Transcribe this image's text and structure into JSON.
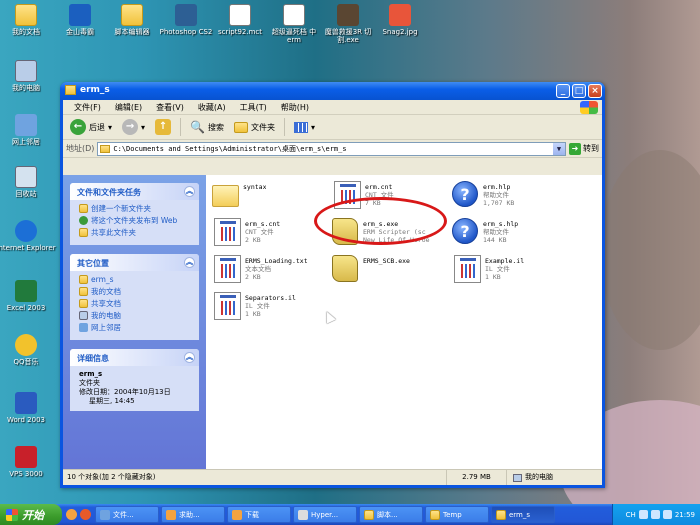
{
  "desktop": {
    "icons": [
      {
        "label": "我的文档"
      },
      {
        "label": "金山毒霸"
      },
      {
        "label": "脚本编辑器"
      },
      {
        "label": "Photoshop CS2"
      },
      {
        "label": "script92.mct"
      },
      {
        "label": "超级逼死档 中 erm"
      },
      {
        "label": "魔兽救援3R 切割.exe"
      },
      {
        "label": "Snag2.jpg"
      },
      {
        "label": "我的电脑"
      },
      {
        "label": "网上邻居"
      },
      {
        "label": "回收站"
      },
      {
        "label": "Internet Explorer"
      },
      {
        "label": "Excel 2003"
      },
      {
        "label": "QQ音乐"
      },
      {
        "label": "Word 2003"
      },
      {
        "label": "VPS 3000"
      }
    ]
  },
  "window": {
    "title": "erm_s",
    "menu": [
      "文件(F)",
      "编辑(E)",
      "查看(V)",
      "收藏(A)",
      "工具(T)",
      "帮助(H)"
    ],
    "toolbar": {
      "back": "后退",
      "search": "搜索",
      "folders": "文件夹"
    },
    "address": {
      "label": "地址(D)",
      "value": "C:\\Documents and Settings\\Administrator\\桌面\\erm_s\\erm_s",
      "go": "转到"
    },
    "tasks_panel": {
      "title": "文件和文件夹任务",
      "items": [
        "创建一个新文件夹",
        "将这个文件夹发布到 Web",
        "共享此文件夹"
      ]
    },
    "places_panel": {
      "title": "其它位置",
      "items": [
        "erm_s",
        "我的文档",
        "共享文档",
        "我的电脑",
        "网上邻居"
      ]
    },
    "details_panel": {
      "title": "详细信息",
      "name": "erm_s",
      "type": "文件夹",
      "modified_label": "修改日期：2004年10月13日",
      "modified_time": "星期三, 14:45"
    },
    "files": [
      {
        "name": "syntax",
        "type": "",
        "size": "",
        "icon": "folder"
      },
      {
        "name": "erm.cnt",
        "type": "CNT 文件",
        "size": "7 KB",
        "icon": "cnt"
      },
      {
        "name": "erm.hlp",
        "type": "帮助文件",
        "size": "1,707 KB",
        "icon": "hlp"
      },
      {
        "name": "erm_s.cnt",
        "type": "CNT 文件",
        "size": "2 KB",
        "icon": "cnt"
      },
      {
        "name": "erm_s.exe",
        "type": "ERM Scripter (sc",
        "size": "New Life Of Heroe",
        "icon": "exe"
      },
      {
        "name": "erm_s.hlp",
        "type": "帮助文件",
        "size": "144 KB",
        "icon": "hlp"
      },
      {
        "name": "ERMS_Loading.txt",
        "type": "文本文档",
        "size": "2 KB",
        "icon": "txt"
      },
      {
        "name": "ERMS_SCB.exe",
        "type": "",
        "size": "",
        "icon": "scroll"
      },
      {
        "name": "Example.il",
        "type": "IL 文件",
        "size": "1 KB",
        "icon": "cnt"
      },
      {
        "name": "Separators.il",
        "type": "IL 文件",
        "size": "1 KB",
        "icon": "cnt"
      }
    ],
    "status": {
      "objects": "10 个对象(加 2 个隐藏对象)",
      "size": "2.79 MB",
      "location": "我的电脑"
    }
  },
  "taskbar": {
    "start": "开始",
    "tasks": [
      "文件...",
      "求助...",
      "下载",
      "Hyper...",
      "脚本...",
      "Temp",
      "erm_s"
    ],
    "active_task": "erm_s",
    "tray": {
      "lang": "CH",
      "clock": "21:59"
    }
  }
}
